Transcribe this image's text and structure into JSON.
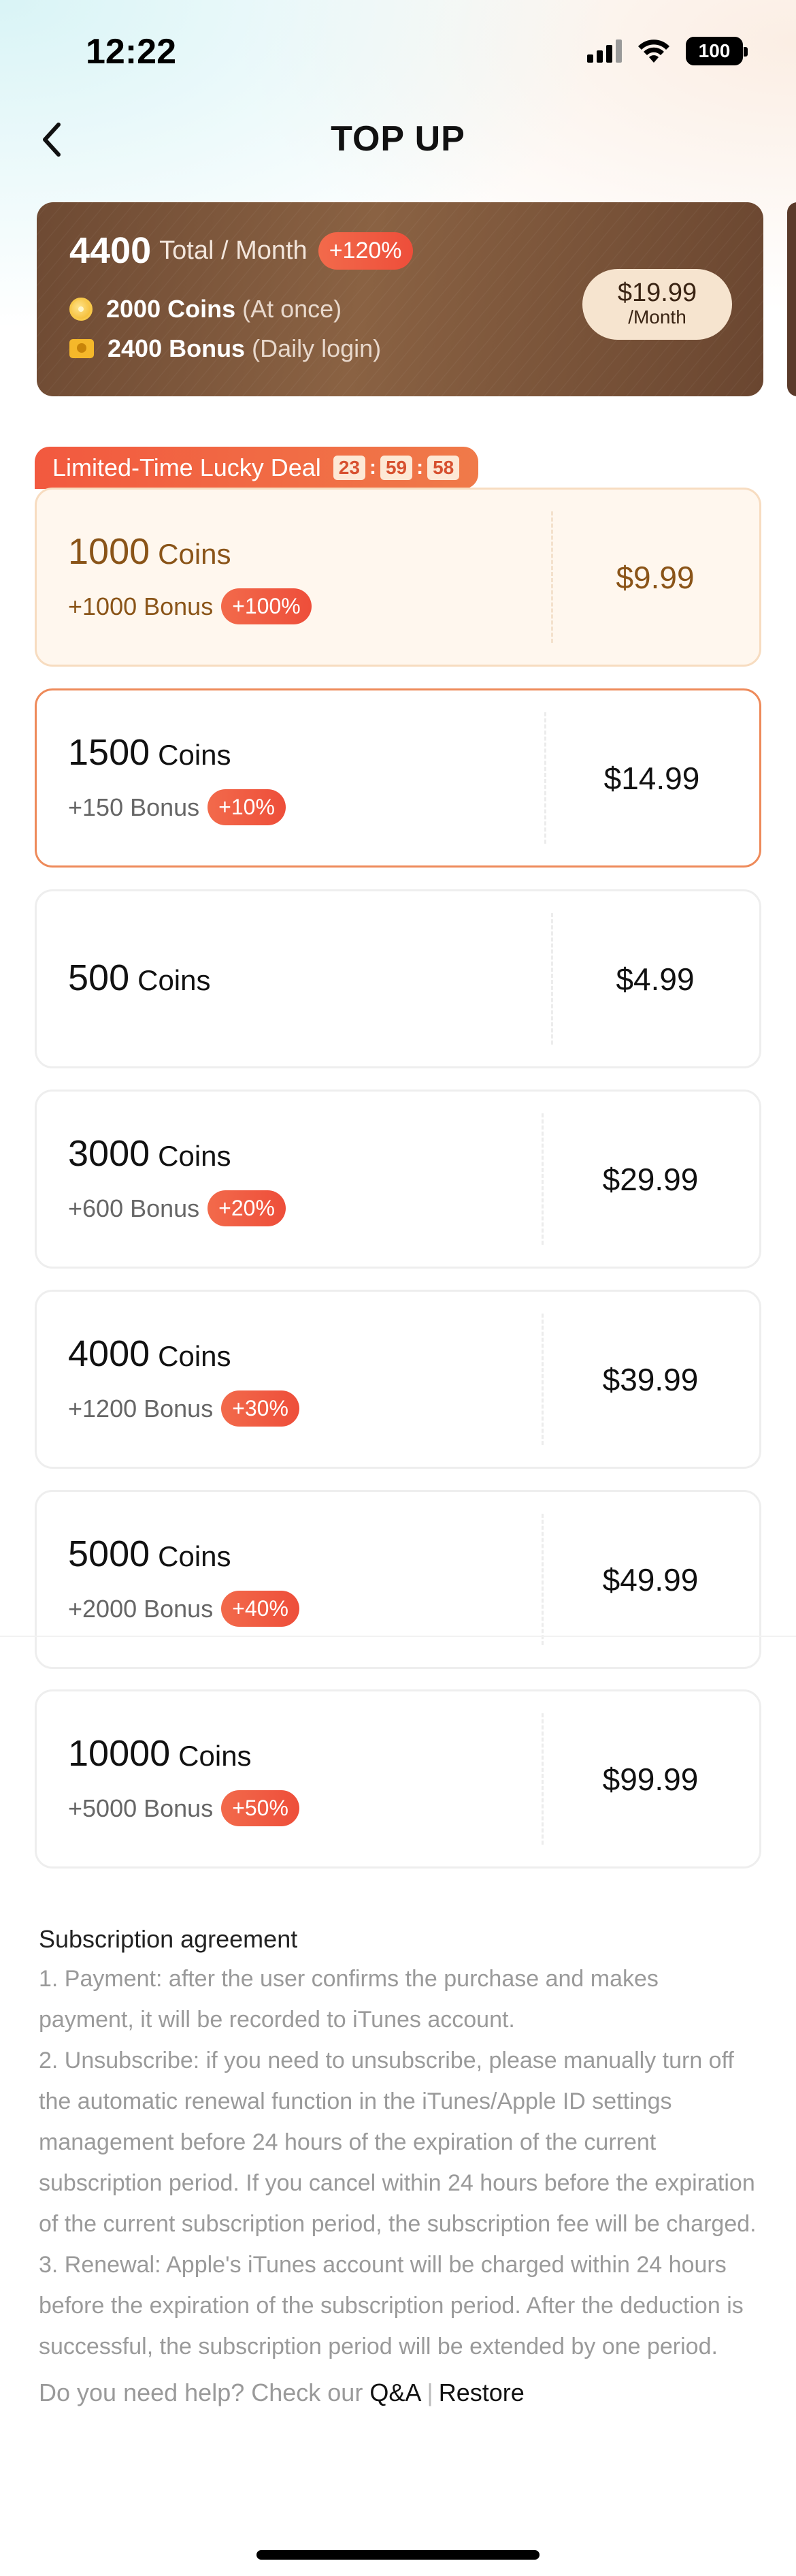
{
  "status_bar": {
    "time": "12:22",
    "battery": "100"
  },
  "header": {
    "title": "TOP UP"
  },
  "subscription": {
    "total": "4400",
    "total_label": "Total / Month",
    "badge": "+120%",
    "line1_amount": "2000 Coins",
    "line1_note": "(At once)",
    "line2_amount": "2400 Bonus",
    "line2_note": "(Daily login)",
    "price": "$19.99",
    "period": "/Month"
  },
  "deal": {
    "label": "Limited-Time Lucky Deal",
    "timer": {
      "hours": "23",
      "minutes": "59",
      "seconds": "58"
    }
  },
  "packages": [
    {
      "coins": "1000",
      "unit": "Coins",
      "bonus": "+1000 Bonus",
      "badge": "+100%",
      "price": "$9.99"
    },
    {
      "coins": "1500",
      "unit": "Coins",
      "bonus": "+150 Bonus",
      "badge": "+10%",
      "price": "$14.99"
    },
    {
      "coins": "500",
      "unit": "Coins",
      "price": "$4.99"
    },
    {
      "coins": "3000",
      "unit": "Coins",
      "bonus": "+600 Bonus",
      "badge": "+20%",
      "price": "$29.99"
    },
    {
      "coins": "4000",
      "unit": "Coins",
      "bonus": "+1200 Bonus",
      "badge": "+30%",
      "price": "$39.99"
    },
    {
      "coins": "5000",
      "unit": "Coins",
      "bonus": "+2000 Bonus",
      "badge": "+40%",
      "price": "$49.99"
    },
    {
      "coins": "10000",
      "unit": "Coins",
      "bonus": "+5000 Bonus",
      "badge": "+50%",
      "price": "$99.99"
    }
  ],
  "agreement": {
    "title": "Subscription agreement",
    "p1": "1. Payment: after the user confirms the purchase and makes payment, it will be recorded to iTunes account.",
    "p2": "2. Unsubscribe: if you need to unsubscribe, please manually turn off the automatic renewal function in the iTunes/Apple ID settings management before 24 hours of the expiration of the current subscription period. If you cancel within 24 hours before the expiration of the current subscription period, the subscription fee will be charged.",
    "p3": "3. Renewal: Apple's iTunes account will be charged within 24 hours before the expiration of the subscription period. After the deduction is successful, the subscription period will be extended by one period.",
    "help_text": "Do you need help? Check our",
    "qa_link": "Q&A",
    "separator": "|",
    "restore_link": "Restore"
  },
  "colors": {
    "accent": "#ee4e3a",
    "selected_border": "#ee8a5a",
    "card_brown": "#7a5238"
  }
}
